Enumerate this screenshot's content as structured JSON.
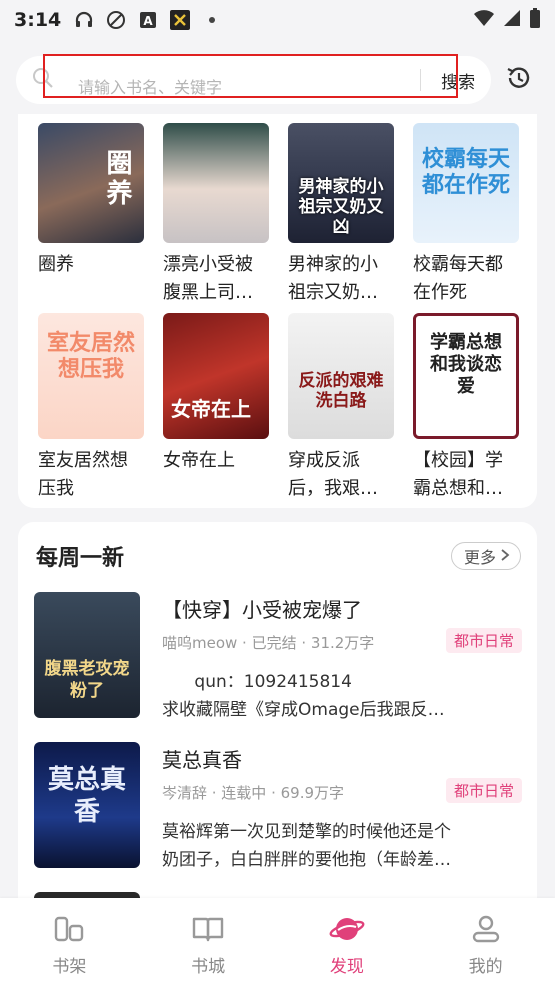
{
  "status_bar": {
    "time": "3:14"
  },
  "search": {
    "placeholder": "请输入书名、关键字",
    "button": "搜索"
  },
  "grid_books": [
    {
      "title": "圈养",
      "cover_text": "圈养"
    },
    {
      "title": "漂亮小受被腹黑上司…"
    },
    {
      "title": "男神家的小祖宗又奶…",
      "cover_text": "男神家的小祖宗又奶又凶"
    },
    {
      "title": "校霸每天都在作死",
      "cover_text": "校霸每天都在作死"
    },
    {
      "title": "室友居然想压我",
      "cover_text": "室友居然想压我"
    },
    {
      "title": "女帝在上",
      "cover_text": "女帝在上"
    },
    {
      "title": "穿成反派后，我艰…",
      "cover_text": "反派的艰难洗白路"
    },
    {
      "title": "【校园】学霸总想和…",
      "cover_text": "学霸总想和我谈恋爱"
    }
  ],
  "weekly": {
    "title": "每周一新",
    "more": "更多",
    "items": [
      {
        "title": "【快穿】小受被宠爆了",
        "meta": "喵呜meow · 已完结 · 31.2万字",
        "tag": "都市日常",
        "desc_line1": "      qun：1092415814",
        "desc_line2": "求收藏隔壁《穿成Omage后我跟反…",
        "cover_text": "腹黑老攻宠粉了"
      },
      {
        "title": "莫总真香",
        "meta": "岑清辞 · 连载中 · 69.9万字",
        "tag": "都市日常",
        "desc_line1": "莫裕辉第一次见到楚擎的时候他还是个",
        "desc_line2": "奶团子，白白胖胖的要他抱（年龄差…",
        "cover_text": "莫总真香"
      }
    ]
  },
  "nav": [
    {
      "label": "书架"
    },
    {
      "label": "书城"
    },
    {
      "label": "发现"
    },
    {
      "label": "我的"
    }
  ],
  "colors": {
    "accent": "#e0407a",
    "highlight_box": "#e02020",
    "background": "#f4f4f6"
  }
}
